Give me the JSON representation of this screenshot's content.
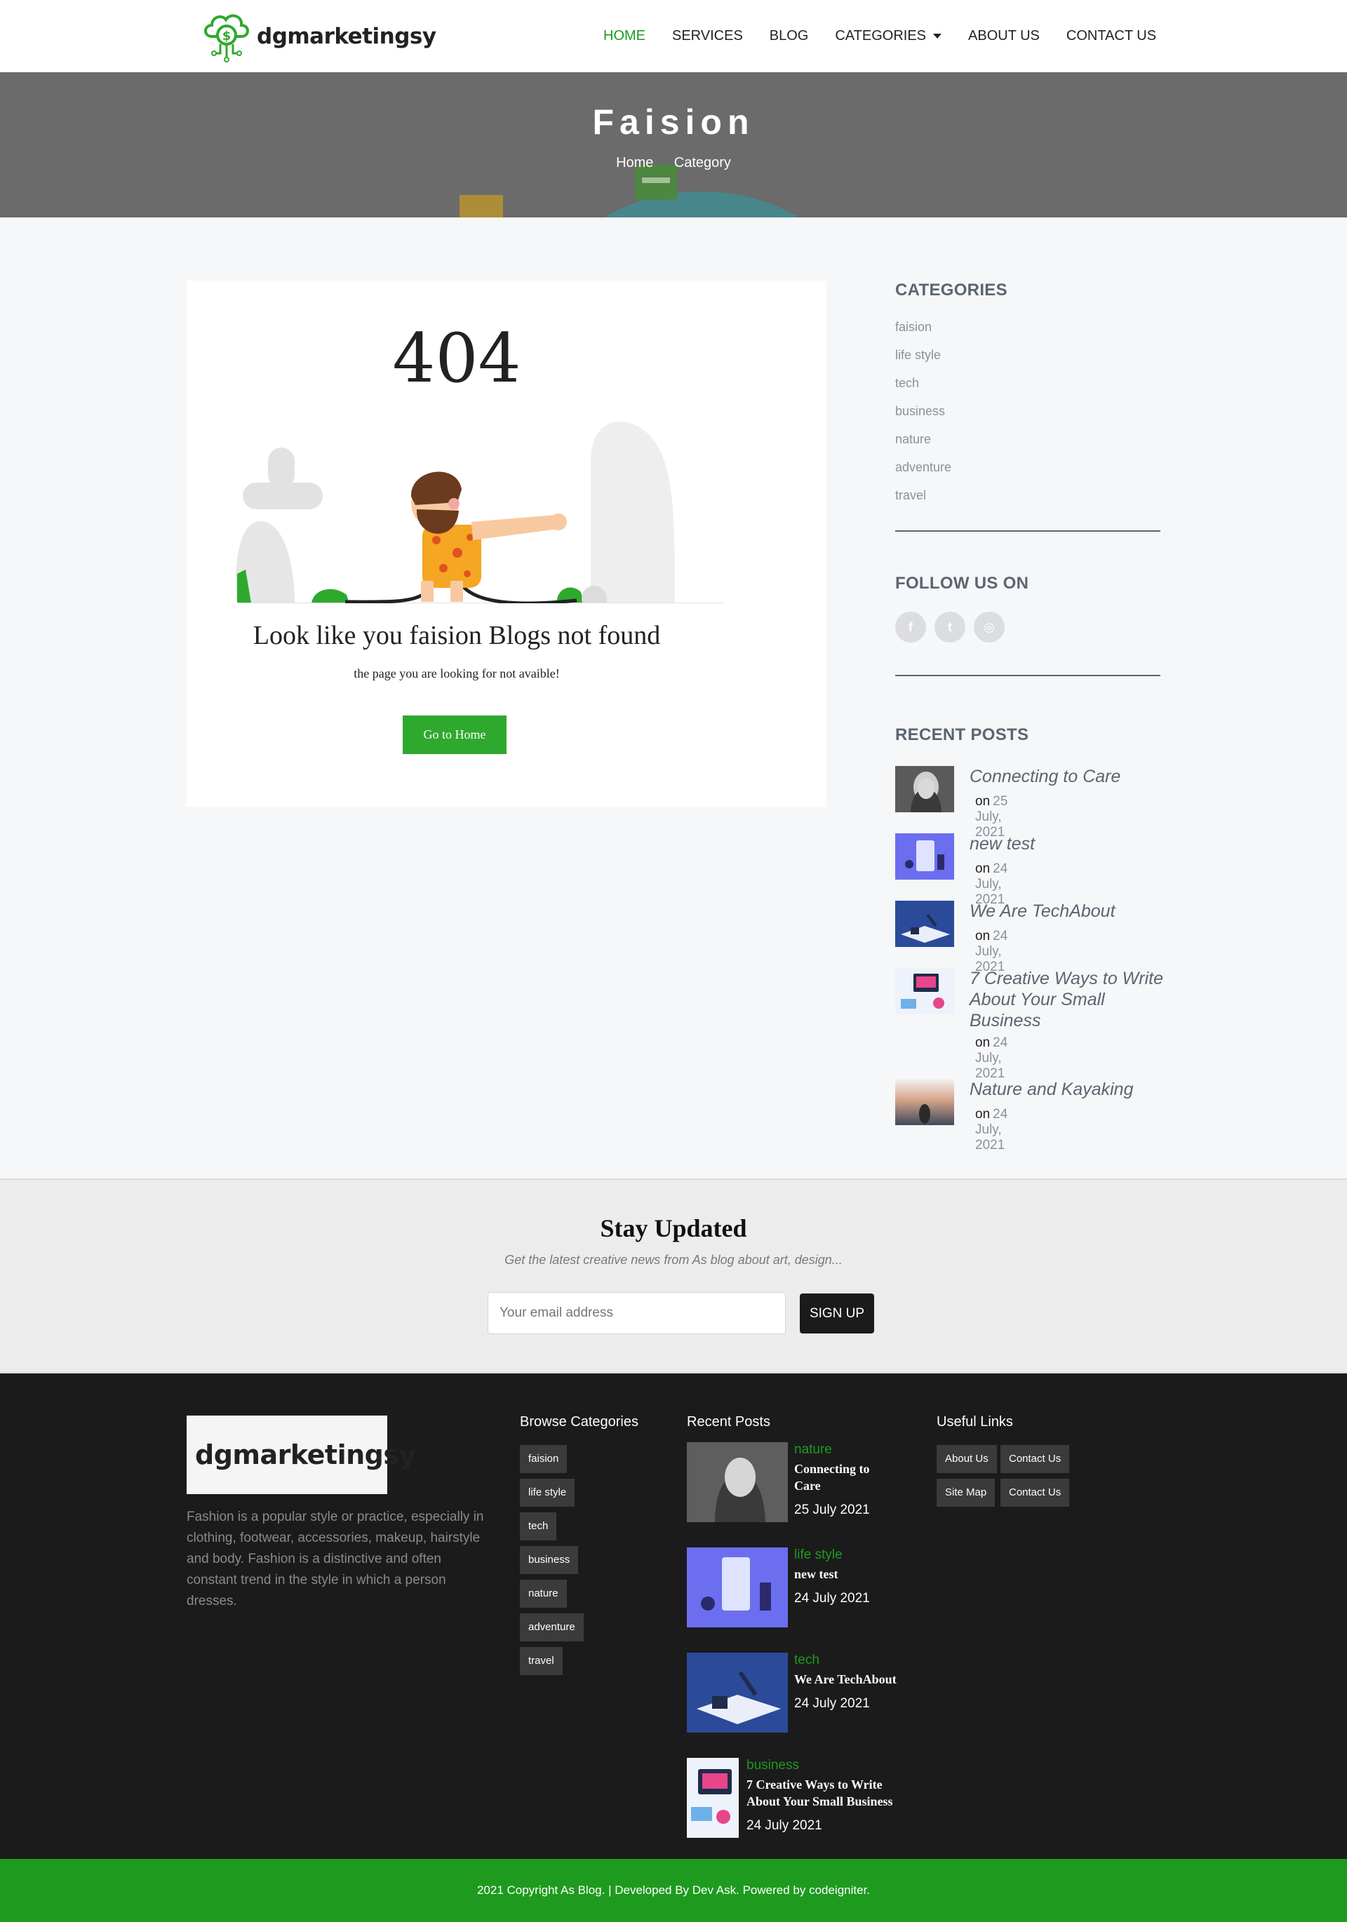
{
  "header": {
    "brand": "dgmarketingsy",
    "nav": [
      {
        "label": "HOME",
        "active": true
      },
      {
        "label": "SERVICES"
      },
      {
        "label": "BLOG"
      },
      {
        "label": "CATEGORIES",
        "dropdown": true
      },
      {
        "label": "ABOUT US"
      },
      {
        "label": "CONTACT US"
      }
    ]
  },
  "hero": {
    "title": "Faision",
    "breadcrumb": [
      "Home",
      "Category"
    ]
  },
  "notfound": {
    "code": "404",
    "title": "Look like you faision Blogs not found",
    "subtitle": "the page you are looking for not avaible!",
    "button": "Go to Home"
  },
  "sidebar": {
    "categories_heading": "CATEGORIES",
    "categories": [
      "faision",
      "life style",
      "tech",
      "business",
      "nature",
      "adventure",
      "travel"
    ],
    "follow_heading": "FOLLOW US ON",
    "social": [
      {
        "icon": "facebook-icon",
        "glyph": "f"
      },
      {
        "icon": "twitter-icon",
        "glyph": "t"
      },
      {
        "icon": "instagram-icon",
        "glyph": "◎"
      }
    ],
    "recent_heading": "RECENT POSTS",
    "recent_on": "on",
    "recent": [
      {
        "title": "Connecting to Care",
        "date": "25 July, 2021"
      },
      {
        "title": "new test",
        "date": "24 July, 2021"
      },
      {
        "title": "We Are TechAbout",
        "date": "24 July, 2021"
      },
      {
        "title": "7 Creative Ways to Write About Your Small Business",
        "date": "24 July, 2021"
      },
      {
        "title": "Nature and Kayaking",
        "date": "24 July, 2021"
      }
    ]
  },
  "newsletter": {
    "title": "Stay Updated",
    "subtitle": "Get the latest creative news from As blog about art, design...",
    "placeholder": "Your email address",
    "button": "SIGN UP"
  },
  "footer": {
    "about": "Fashion is a popular style or practice, especially in clothing, footwear, accessories, makeup, hairstyle and body. Fashion is a distinctive and often constant trend in the style in which a person dresses.",
    "categories_heading": "Browse Categories",
    "categories": [
      "faision",
      "life style",
      "tech",
      "business",
      "nature",
      "adventure",
      "travel"
    ],
    "recent_heading": "Recent Posts",
    "recent": [
      {
        "category": "nature",
        "title": "Connecting to Care",
        "date": "25 July 2021"
      },
      {
        "category": "life style",
        "title": "new test",
        "date": "24 July 2021"
      },
      {
        "category": "tech",
        "title": "We Are TechAbout",
        "date": "24 July 2021"
      },
      {
        "category": "business",
        "title": "7 Creative Ways to Write About Your Small Business",
        "date": "24 July 2021"
      }
    ],
    "links_heading": "Useful Links",
    "links": [
      "About Us",
      "Contact Us",
      "Site Map",
      "Contact Us"
    ],
    "copyright": "2021 Copyright As Blog. | Developed By Dev Ask. Powered by codeigniter."
  },
  "colors": {
    "accent": "#1e9a1e",
    "dark": "#1b1b1b",
    "muted": "#5b6570"
  }
}
